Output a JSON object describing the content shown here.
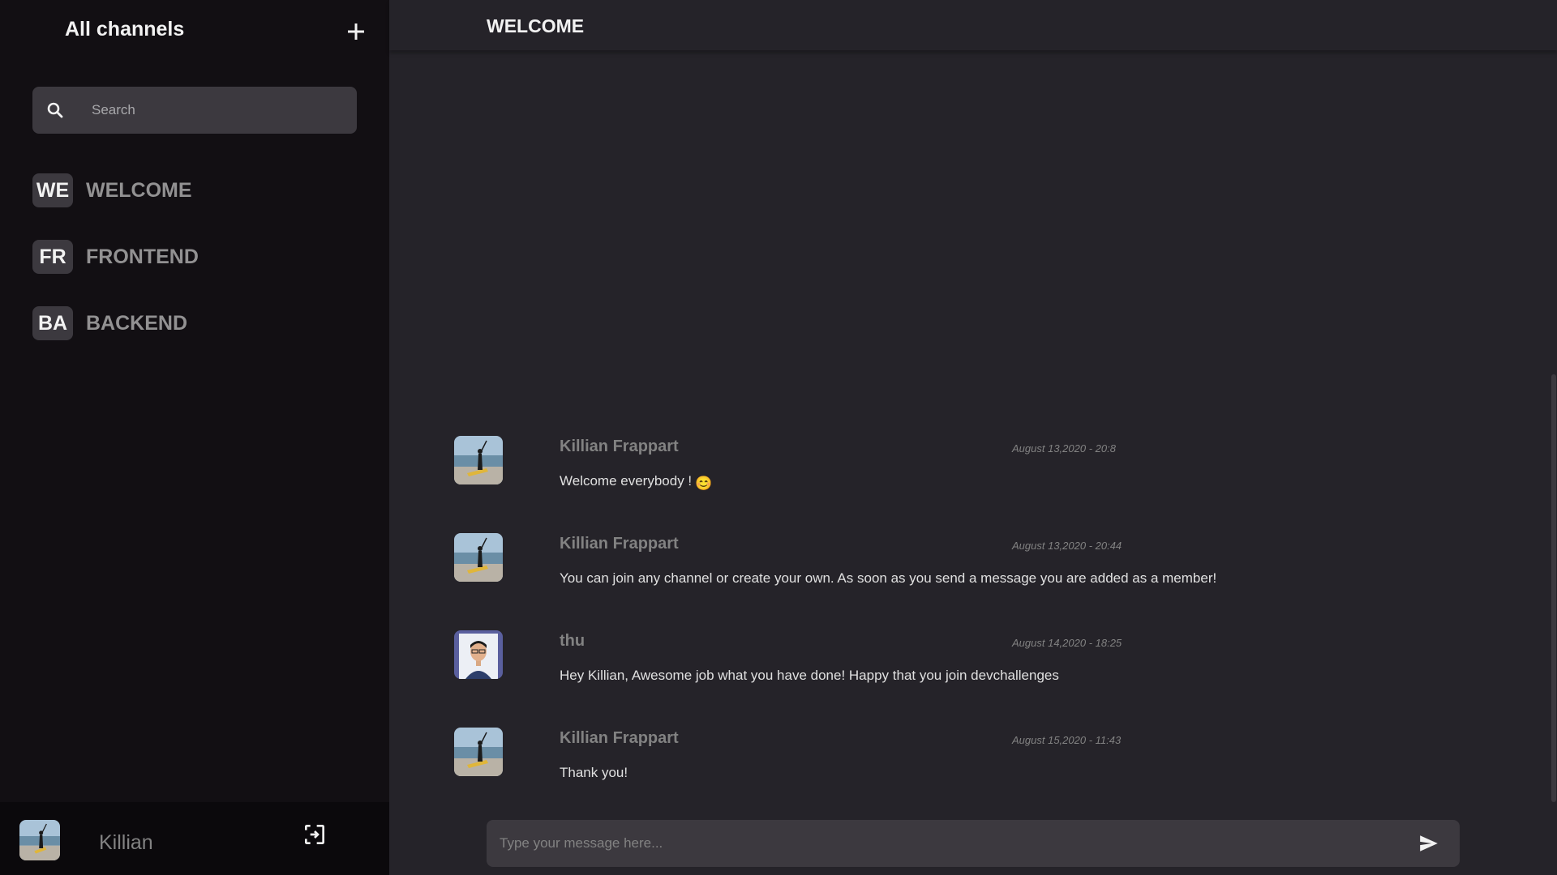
{
  "sidebar": {
    "title": "All channels",
    "search": {
      "placeholder": "Search",
      "value": ""
    },
    "channels": [
      {
        "abbr": "WE",
        "name": "WELCOME"
      },
      {
        "abbr": "FR",
        "name": "FRONTEND"
      },
      {
        "abbr": "BA",
        "name": "BACKEND"
      }
    ],
    "user": {
      "name": "Killian"
    }
  },
  "header": {
    "title": "WELCOME"
  },
  "messages": [
    {
      "author": "Killian Frappart",
      "time": "August 13,2020 - 20:8",
      "text": "Welcome everybody !",
      "emoji": "😊"
    },
    {
      "author": "Killian Frappart",
      "time": "August 13,2020 - 20:44",
      "text": "You can join any channel or create your own. As soon as you send a message you are added as a member!"
    },
    {
      "author": "thu",
      "time": "August 14,2020 - 18:25",
      "text": "Hey Killian, Awesome job what you have done! Happy that you join devchallenges"
    },
    {
      "author": "Killian Frappart",
      "time": "August 15,2020 - 11:43",
      "text": "Thank you!"
    }
  ],
  "composer": {
    "placeholder": "Type your message here...",
    "value": ""
  },
  "colors": {
    "sidebar_bg": "#120f13",
    "main_bg": "#252329",
    "input_bg": "#3c393f",
    "footer_bg": "#0b090c",
    "text_primary": "#f2f2f2",
    "text_muted": "#828282"
  },
  "icons": {
    "add": "plus-icon",
    "search": "search-icon",
    "logout": "logout-icon",
    "send": "send-icon"
  }
}
